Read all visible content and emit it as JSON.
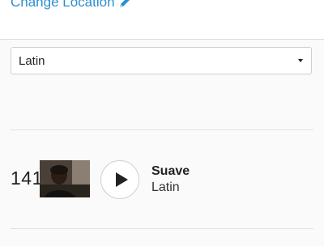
{
  "header": {
    "change_location_label": "Change Location",
    "icon": "pencil-icon",
    "link_color": "#2a8fd0"
  },
  "genre_select": {
    "selected": "Latin"
  },
  "songs": [
    {
      "rank": "141",
      "title": "Suave",
      "genre": "Latin",
      "thumbnail": "artist-photo"
    }
  ]
}
